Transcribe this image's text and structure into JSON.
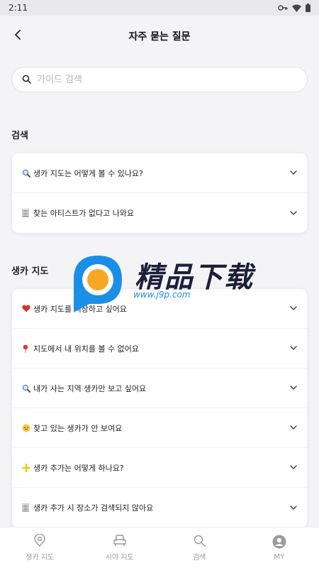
{
  "status_bar": {
    "time": "2:11"
  },
  "header": {
    "title": "자주 묻는 질문"
  },
  "search": {
    "placeholder": "가이드 검색"
  },
  "sections": [
    {
      "title": "검색",
      "items": [
        {
          "icon": "magnifier-emoji-icon",
          "label": "생카 지도는 어떻게 볼 수 있나요?"
        },
        {
          "icon": "list-emoji-icon",
          "label": "찾는 아티스트가 없다고 나와요"
        }
      ]
    },
    {
      "title": "생카 지도",
      "items": [
        {
          "icon": "heart-emoji-icon",
          "label": "생카 지도를 저장하고 싶어요"
        },
        {
          "icon": "pin-emoji-icon",
          "label": "지도에서 내 위치를 볼 수 없어요"
        },
        {
          "icon": "magnifier-emoji-icon",
          "label": "내가 사는 지역 생카만 보고 싶어요"
        },
        {
          "icon": "face-emoji-icon",
          "label": "찾고 있는 생카가 안 보여요"
        },
        {
          "icon": "plus-emoji-icon",
          "label": "생카 추가는 어떻게 하나요?"
        },
        {
          "icon": "list-emoji-icon",
          "label": "생카 추가 시 장소가 검색되지 않아요"
        }
      ]
    }
  ],
  "bottom_nav": [
    {
      "label": "생카 지도",
      "icon": "map-pin-icon"
    },
    {
      "label": "시야 지도",
      "icon": "seat-icon"
    },
    {
      "label": "검색",
      "icon": "search-icon"
    },
    {
      "label": "MY",
      "icon": "profile-icon"
    }
  ],
  "watermark": {
    "title": "精品下载",
    "url": "www.j9p.com"
  },
  "colors": {
    "accent_blue": "#1b8ee8",
    "orange": "#f7a823",
    "heart": "#d0342c"
  }
}
